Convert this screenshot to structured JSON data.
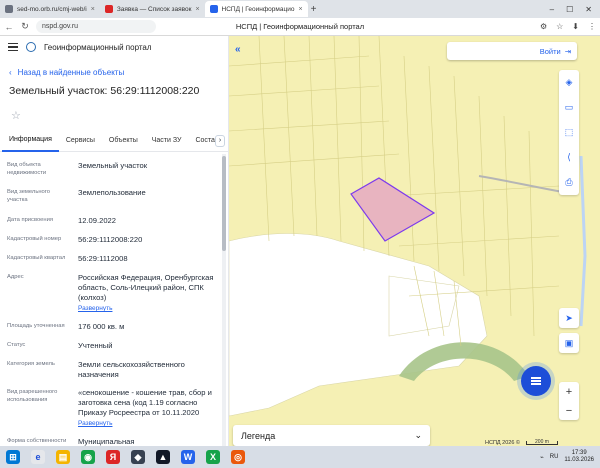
{
  "browser": {
    "tabs": [
      {
        "label": "sed-mo.orb.ru/cmj-web/i",
        "color": "#6b7280",
        "active": false
      },
      {
        "label": "Заявка — Список заявок",
        "color": "#dc2626",
        "active": false
      },
      {
        "label": "НСПД | Геоинформацио",
        "color": "#2563eb",
        "active": true
      }
    ],
    "new_tab": "+",
    "address": "nspd.gov.ru",
    "page_title": "НСПД | Геоинформационный портал",
    "win_min": "–",
    "win_max": "☐",
    "win_close": "✕"
  },
  "app": {
    "name": "Геоинформационный портал",
    "back_label": "Назад в найденные объекты",
    "title": "Земельный участок: 56:29:1112008:220",
    "star": "☆",
    "tabs": [
      "Информация",
      "Сервисы",
      "Объекты",
      "Части ЗУ",
      "Соста"
    ],
    "tabs_more": "›"
  },
  "info_rows": [
    {
      "label": "Вид объекта недвижимости",
      "value": "Земельный участок"
    },
    {
      "label": "Вид земельного участка",
      "value": "Землепользование"
    },
    {
      "label": "Дата присвоения",
      "value": "12.09.2022"
    },
    {
      "label": "Кадастровый номер",
      "value": "56:29:1112008:220"
    },
    {
      "label": "Кадастровый квартал",
      "value": "56:29:1112008"
    },
    {
      "label": "Адрес",
      "value": "Российская Федерация, Оренбургская область, Соль-Илецкий район, СПК (колхоз)",
      "link": "Развернуть"
    },
    {
      "label": "Площадь уточненная",
      "value": "176 000 кв. м"
    },
    {
      "label": "Статус",
      "value": "Учтенный"
    },
    {
      "label": "Категория земель",
      "value": "Земли сельскохозяйственного назначения"
    },
    {
      "label": "Вид разрешенного использования",
      "value": "«сенокошение - кошение трав, сбор и заготовка сена (код 1.19 согласно Приказу Росреестра от 10.11.2020",
      "link": "Развернуть"
    },
    {
      "label": "Форма собственности",
      "value": "Муниципальная"
    }
  ],
  "map": {
    "collapse": "«",
    "login": "Войти",
    "legend": "Легенда",
    "legend_chevron": "⌄",
    "attribution": "НСПД 2026 ©",
    "scale": "200 m",
    "zoom_in": "+",
    "zoom_out": "−",
    "parcel_fill": "#e8b4c0",
    "parcel_stroke": "#7c3aed"
  },
  "taskbar": {
    "lang": "RU",
    "time": "17:39",
    "date": "11.03.2026"
  }
}
